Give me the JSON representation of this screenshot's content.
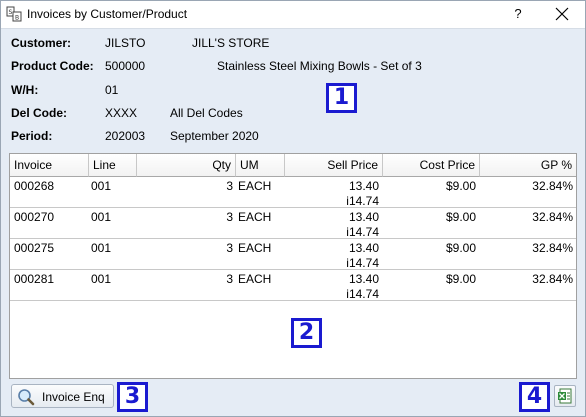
{
  "window": {
    "title": "Invoices by Customer/Product",
    "help_label": "?",
    "close_label": "✕"
  },
  "header": {
    "customer_label": "Customer:",
    "customer_code": "JILSTO",
    "customer_name": "JILL'S STORE",
    "product_label": "Product Code:",
    "product_code": "500000",
    "product_desc": "Stainless Steel Mixing Bowls - Set of 3",
    "wh_label": "W/H:",
    "wh_value": "01",
    "delcode_label": "Del Code:",
    "delcode_value": "XXXX",
    "delcode_desc": "All Del Codes",
    "period_label": "Period:",
    "period_value": "202003",
    "period_desc": "September 2020"
  },
  "badges": {
    "b1": "1",
    "b2": "2",
    "b3": "3",
    "b4": "4"
  },
  "grid": {
    "columns": [
      "Invoice",
      "Line",
      "Qty",
      "UM",
      "Sell Price",
      "Cost Price",
      "GP %"
    ],
    "rows": [
      {
        "invoice": "000268",
        "line": "001",
        "qty": "3",
        "um": "EACH",
        "sell": "13.40",
        "sell2": "i14.74",
        "cost": "$9.00",
        "gp": "32.84%"
      },
      {
        "invoice": "000270",
        "line": "001",
        "qty": "3",
        "um": "EACH",
        "sell": "13.40",
        "sell2": "i14.74",
        "cost": "$9.00",
        "gp": "32.84%"
      },
      {
        "invoice": "000275",
        "line": "001",
        "qty": "3",
        "um": "EACH",
        "sell": "13.40",
        "sell2": "i14.74",
        "cost": "$9.00",
        "gp": "32.84%"
      },
      {
        "invoice": "000281",
        "line": "001",
        "qty": "3",
        "um": "EACH",
        "sell": "13.40",
        "sell2": "i14.74",
        "cost": "$9.00",
        "gp": "32.84%"
      }
    ]
  },
  "footer": {
    "invoice_enq_label": "Invoice Enq",
    "invoice_enq_icon": "magnifier-icon",
    "export_icon": "excel-export-icon"
  },
  "colors": {
    "badge": "#1a1ad0",
    "background": "#e5ecf5"
  }
}
